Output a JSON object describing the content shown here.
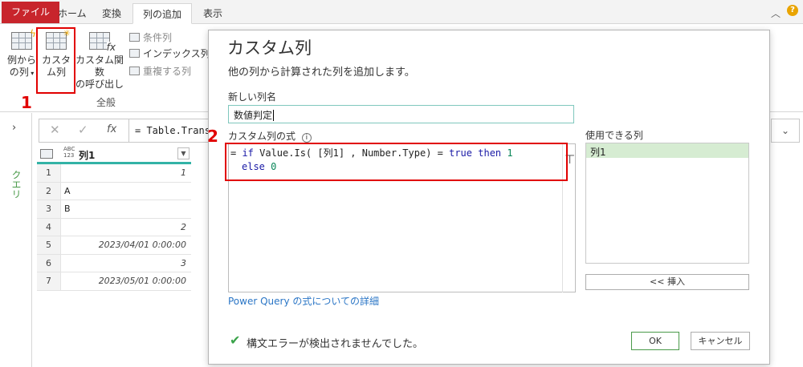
{
  "ribbon": {
    "tabs": [
      {
        "label": "ファイル"
      },
      {
        "label": "ホーム"
      },
      {
        "label": "変換"
      },
      {
        "label": "列の追加"
      },
      {
        "label": "表示"
      }
    ],
    "example_col_line1": "例から",
    "example_col_line2": "の列",
    "custom_col_line1": "カスタ",
    "custom_col_line2": "ム列",
    "invoke_fn_line1": "カスタム関数",
    "invoke_fn_line2": "の呼び出し",
    "conditional_col": "条件列",
    "index_col": "インデックス列",
    "duplicate_col": "重複する列",
    "group_label": "全般",
    "marker1": "1"
  },
  "formula_bar": {
    "text": "= Table.Trans"
  },
  "left_panel": {
    "queries_label": "クエリ"
  },
  "grid": {
    "header_type": "ABC\n123",
    "column_name": "列1",
    "rows": [
      {
        "n": "1",
        "v": "1",
        "type": "num"
      },
      {
        "n": "2",
        "v": "A",
        "type": "text"
      },
      {
        "n": "3",
        "v": "B",
        "type": "text"
      },
      {
        "n": "4",
        "v": "2",
        "type": "num"
      },
      {
        "n": "5",
        "v": "2023/04/01 0:00:00",
        "type": "num"
      },
      {
        "n": "6",
        "v": "3",
        "type": "num"
      },
      {
        "n": "7",
        "v": "2023/05/01 0:00:00",
        "type": "num"
      }
    ]
  },
  "dialog": {
    "title": "カスタム列",
    "subtitle": "他の列から計算された列を追加します。",
    "new_col_label": "新しい列名",
    "new_col_value": "数値判定",
    "formula_label": "カスタム列の式",
    "formula_line1_prefix": "= ",
    "formula_kw_if": "if",
    "formula_mid": " Value.Is( [列1] , Number.Type) = ",
    "formula_kw_true": "true",
    "formula_kw_then": " then ",
    "formula_num1": "1",
    "formula_kw_else": "else",
    "formula_num0": "0",
    "available_label": "使用できる列",
    "available_items": [
      "列1"
    ],
    "insert_button": "<< 挿入",
    "learn_link": "Power Query の式についての詳細",
    "status_text": "構文エラーが検出されませんでした。",
    "ok_button": "OK",
    "cancel_button": "キャンセル",
    "marker2": "2"
  }
}
